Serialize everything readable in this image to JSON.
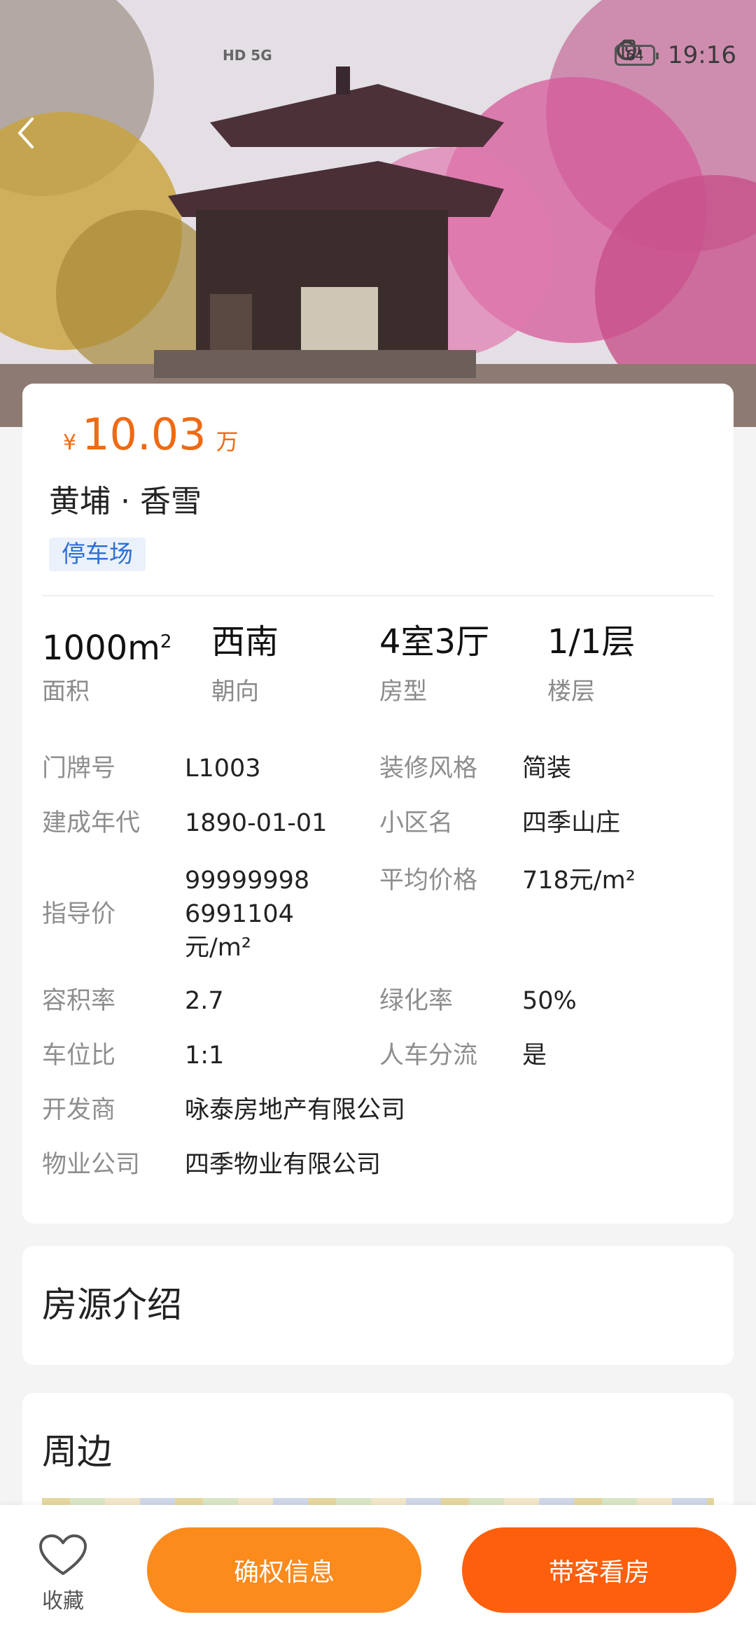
{
  "status_bar": {
    "network_label": "HD 5G",
    "battery": "64",
    "time": "19:16"
  },
  "listing": {
    "currency": "¥",
    "price": "10.03",
    "price_unit": "万",
    "title": "黄埔 · 香雪",
    "tag": "停车场"
  },
  "specs": [
    {
      "value": "1000m",
      "sup": "2",
      "label": "面积"
    },
    {
      "value": "西南",
      "sup": "",
      "label": "朝向"
    },
    {
      "value": "4室3厅",
      "sup": "",
      "label": "房型"
    },
    {
      "value": "1/1层",
      "sup": "",
      "label": "楼层"
    }
  ],
  "details": {
    "door_no_label": "门牌号",
    "door_no": "L1003",
    "decor_label": "装修风格",
    "decor": "简装",
    "built_label": "建成年代",
    "built": "1890-01-01",
    "community_label": "小区名",
    "community": "四季山庄",
    "guide_label": "指导价",
    "guide": "999999986991104元/m²",
    "avg_label": "平均价格",
    "avg": "718元/m²",
    "far_label": "容积率",
    "far": "2.7",
    "green_label": "绿化率",
    "green": "50%",
    "parking_label": "车位比",
    "parking": "1:1",
    "separation_label": "人车分流",
    "separation": "是",
    "developer_label": "开发商",
    "developer": "咏泰房地产有限公司",
    "property_label": "物业公司",
    "property": "四季物业有限公司"
  },
  "sections": {
    "intro": "房源介绍",
    "nearby": "周边"
  },
  "bottom_bar": {
    "favorite": "收藏",
    "confirm": "确权信息",
    "visit": "带客看房"
  },
  "colors": {
    "price": "#ef6a12",
    "confirm_button": "#fb8b1c",
    "visit_button": "#fd5f0c",
    "tag_text": "#2f6fd6"
  }
}
